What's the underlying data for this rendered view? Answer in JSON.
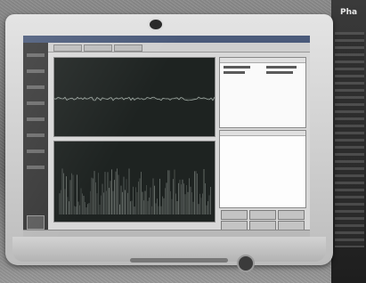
{
  "right_panel": {
    "caption": "Pha"
  },
  "icons": {
    "webcam": "webcam-icon",
    "power": "power-icon"
  },
  "colors": {
    "screen_bg": "#d8d8d8",
    "plot_bg": "#1e2321",
    "trace": "#cfd8d2",
    "bezel": "#d9d9d9"
  }
}
